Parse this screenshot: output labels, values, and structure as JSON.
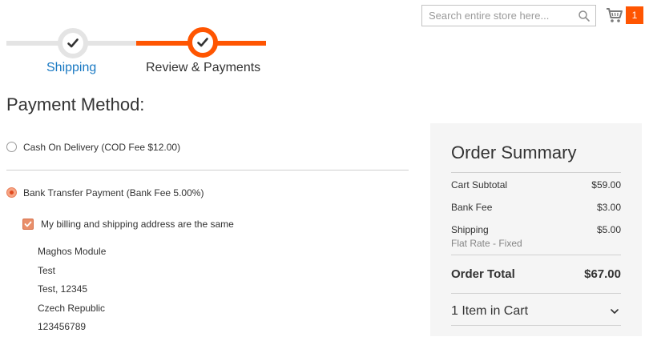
{
  "header": {
    "search_placeholder": "Search entire store here...",
    "cart_count": "1"
  },
  "progress": {
    "steps": [
      {
        "label": "Shipping",
        "state": "complete"
      },
      {
        "label": "Review & Payments",
        "state": "active"
      }
    ]
  },
  "payment": {
    "title": "Payment Method:",
    "methods": [
      {
        "label": "Cash On Delivery (COD Fee $12.00)",
        "selected": false
      },
      {
        "label": "Bank Transfer Payment (Bank Fee 5.00%)",
        "selected": true
      }
    ],
    "same_address_label": "My billing and shipping address are the same",
    "same_address_checked": true,
    "address": {
      "name": "Maghos Module",
      "street": "Test",
      "city_zip": "Test, 12345",
      "country": "Czech Republic",
      "phone": "123456789"
    }
  },
  "summary": {
    "title": "Order Summary",
    "rows": [
      {
        "label": "Cart Subtotal",
        "value": "$59.00"
      },
      {
        "label": "Bank Fee",
        "value": "$3.00"
      },
      {
        "label": "Shipping",
        "sub": "Flat Rate - Fixed",
        "value": "$5.00"
      }
    ],
    "total_label": "Order Total",
    "total_value": "$67.00",
    "items_in_cart": "1 Item in Cart"
  },
  "colors": {
    "accent": "#ff5501",
    "link": "#1979c3",
    "summary_bg": "#f5f5f5"
  }
}
